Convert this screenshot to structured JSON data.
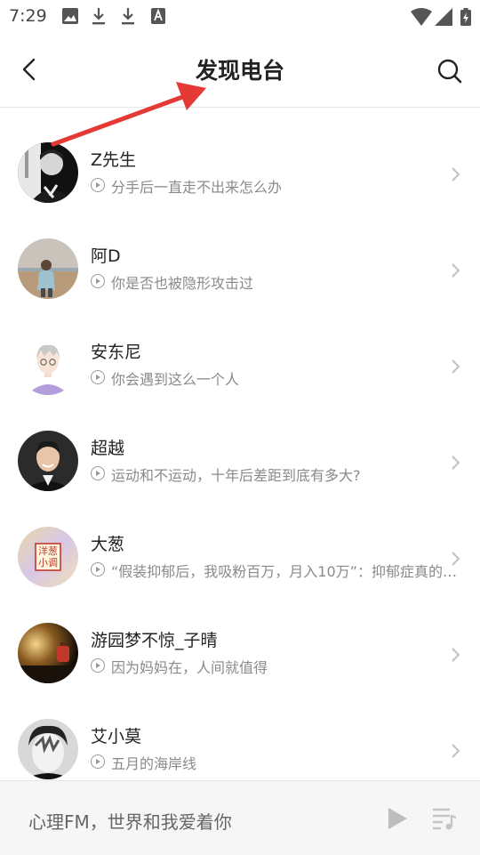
{
  "status": {
    "time": "7:29"
  },
  "header": {
    "title": "发现电台"
  },
  "stations": [
    {
      "name": "Z先生",
      "subtitle": "分手后一直走不出来怎么办"
    },
    {
      "name": "阿D",
      "subtitle": "你是否也被隐形攻击过"
    },
    {
      "name": "安东尼",
      "subtitle": "你会遇到这么一个人"
    },
    {
      "name": "超越",
      "subtitle": "运动和不运动，十年后差距到底有多大?"
    },
    {
      "name": "大葱",
      "subtitle": "“假装抑郁后，我吸粉百万，月入10万”：抑郁症真的能…",
      "avatar_text": "洋葱小调"
    },
    {
      "name": "游园梦不惊_子晴",
      "subtitle": "因为妈妈在，人间就值得"
    },
    {
      "name": "艾小莫",
      "subtitle": "五月的海岸线"
    }
  ],
  "player": {
    "now_playing": "心理FM，世界和我爱着你"
  },
  "colors": {
    "annotation_arrow": "#e53935",
    "accent_text": "#222222",
    "muted_text": "#8a8a8a"
  },
  "icons": [
    "image-icon",
    "download-icon",
    "download-icon",
    "font-a-icon",
    "wifi-icon",
    "signal-icon",
    "battery-icon",
    "back-arrow-icon",
    "search-icon",
    "play-circle-icon",
    "chevron-right-icon",
    "play-icon",
    "playlist-icon"
  ]
}
